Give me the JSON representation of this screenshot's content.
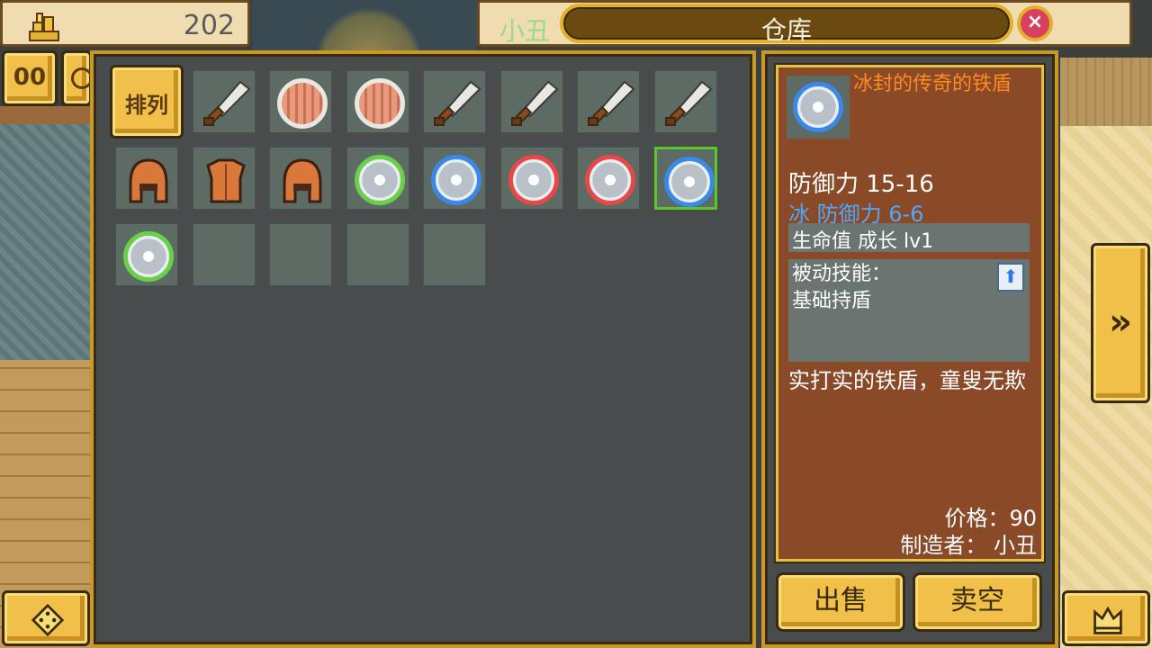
{
  "hud": {
    "gold_value": "202",
    "player_name": "小丑",
    "title": "仓库",
    "close_glyph": "×",
    "pause_glyph": "00"
  },
  "inventory": {
    "sort_label": "排列",
    "slots": [
      {
        "item": "sword"
      },
      {
        "item": "wood-shield"
      },
      {
        "item": "wood-shield"
      },
      {
        "item": "sword"
      },
      {
        "item": "sword"
      },
      {
        "item": "sword"
      },
      {
        "item": "sword"
      },
      {
        "item": "helmet"
      },
      {
        "item": "armor"
      },
      {
        "item": "helmet"
      },
      {
        "item": "shield",
        "ring": "#6ad04a"
      },
      {
        "item": "shield",
        "ring": "#3a88e8"
      },
      {
        "item": "shield",
        "ring": "#e84848"
      },
      {
        "item": "shield",
        "ring": "#e84848"
      },
      {
        "item": "shield",
        "ring": "#3a88e8",
        "selected": true
      },
      {
        "item": "shield",
        "ring": "#6ad04a"
      },
      {
        "item": "empty"
      },
      {
        "item": "empty"
      },
      {
        "item": "empty"
      },
      {
        "item": "empty"
      }
    ]
  },
  "detail": {
    "name": "冰封的传奇的铁盾",
    "defense": "防御力 15-16",
    "ice_defense": "冰 防御力 6-6",
    "growth": "生命值 成长 lv1",
    "skill_title": "被动技能：",
    "skill_name": "基础持盾",
    "description": "实打实的铁盾，童叟无欺",
    "price": "价格：90",
    "maker": "制造者： 小丑",
    "icon_ring": "#3a88e8"
  },
  "actions": {
    "sell": "出售",
    "sell_all": "卖空"
  },
  "side": {
    "next_glyph": "»"
  }
}
